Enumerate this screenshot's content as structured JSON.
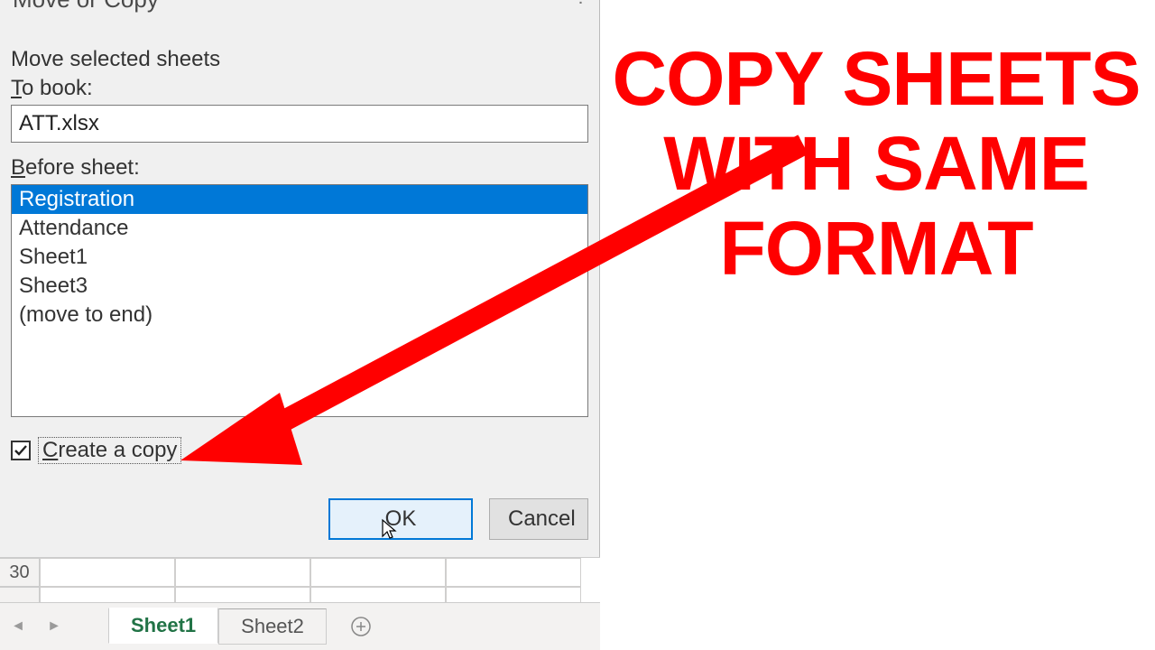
{
  "dialog": {
    "title": "Move or Copy",
    "help_glyph": "?",
    "subtitle": "Move selected sheets",
    "to_book_label": "To book:",
    "to_book_value": "ATT.xlsx",
    "before_sheet_label": "Before sheet:",
    "sheets": [
      "Registration",
      "Attendance",
      "Sheet1",
      "Sheet3",
      "(move to end)"
    ],
    "selected_sheet_index": 0,
    "create_copy_label": "Create a copy",
    "create_copy_checked": true,
    "ok_label": "OK",
    "cancel_label": "Cancel"
  },
  "spreadsheet": {
    "visible_row_headers": [
      "30",
      ""
    ],
    "tabs": [
      "Sheet1",
      "Sheet2"
    ],
    "active_tab_index": 0
  },
  "annotation": {
    "line1": "COPY SHEETS",
    "line2": "WITH SAME",
    "line3": "FORMAT",
    "color": "#ff0000"
  }
}
